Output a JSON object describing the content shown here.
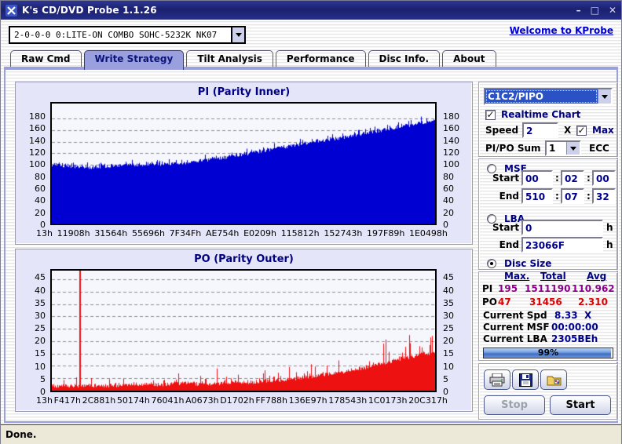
{
  "window": {
    "title": "K's CD/DVD Probe 1.1.26",
    "minimize_glyph": "–",
    "maximize_glyph": "□",
    "close_glyph": "✕"
  },
  "toolbar": {
    "drive": "2-0-0-0 0:LITE-ON COMBO SOHC-5232K NK07",
    "welcome_link": "Welcome to KProbe"
  },
  "tabs": [
    {
      "label": "Raw Cmd",
      "active": false
    },
    {
      "label": "Write Strategy",
      "active": true
    },
    {
      "label": "Tilt Analysis",
      "active": false
    },
    {
      "label": "Performance",
      "active": false
    },
    {
      "label": "Disc Info.",
      "active": false
    },
    {
      "label": "About",
      "active": false
    }
  ],
  "chart_data": [
    {
      "name": "pi-parity-inner",
      "type": "area",
      "title": "PI (Parity Inner)",
      "color": "#0000d2",
      "plot_bg": "#f6f6fd",
      "ylim": [
        0,
        205
      ],
      "yticks": [
        0,
        20,
        40,
        60,
        80,
        100,
        120,
        140,
        160,
        180
      ],
      "x_labels": [
        "13h",
        "11908h",
        "31564h",
        "55696h",
        "7F34Fh",
        "AE754h",
        "E0209h",
        "115812h",
        "152743h",
        "197F89h",
        "1E0498h"
      ],
      "trend": [
        [
          0,
          100
        ],
        [
          0.05,
          98
        ],
        [
          0.1,
          96
        ],
        [
          0.15,
          98
        ],
        [
          0.2,
          100
        ],
        [
          0.25,
          101
        ],
        [
          0.3,
          102
        ],
        [
          0.35,
          104
        ],
        [
          0.4,
          108
        ],
        [
          0.45,
          113
        ],
        [
          0.5,
          118
        ],
        [
          0.55,
          124
        ],
        [
          0.6,
          130
        ],
        [
          0.65,
          136
        ],
        [
          0.7,
          141
        ],
        [
          0.75,
          146
        ],
        [
          0.8,
          152
        ],
        [
          0.85,
          158
        ],
        [
          0.9,
          164
        ],
        [
          0.95,
          170
        ],
        [
          1,
          176
        ]
      ],
      "noise": {
        "base_offset": -3,
        "jitter": 6,
        "spike_prob": 0.35,
        "spike_max": 13,
        "spike_grow": 0.15
      },
      "min_value": 0,
      "seed": 20050
    },
    {
      "name": "po-parity-outer",
      "type": "area",
      "title": "PO (Parity Outer)",
      "color": "#ee1111",
      "plot_bg": "#f6f6fd",
      "ylim": [
        0,
        48.5
      ],
      "yticks": [
        0,
        5,
        10,
        15,
        20,
        25,
        30,
        35,
        40,
        45
      ],
      "x_labels": [
        "13h",
        "F417h",
        "2C881h",
        "50174h",
        "76041h",
        "A0673h",
        "D1702h",
        "FF788h",
        "136E97h",
        "178543h",
        "1C0173h",
        "20C317h"
      ],
      "trend": [
        [
          0,
          2
        ],
        [
          0.1,
          2
        ],
        [
          0.2,
          2.2
        ],
        [
          0.3,
          2.6
        ],
        [
          0.35,
          3
        ],
        [
          0.4,
          2.6
        ],
        [
          0.45,
          3
        ],
        [
          0.5,
          3.3
        ],
        [
          0.55,
          3.8
        ],
        [
          0.6,
          4.4
        ],
        [
          0.65,
          5.2
        ],
        [
          0.7,
          6.2
        ],
        [
          0.75,
          7.4
        ],
        [
          0.8,
          8.8
        ],
        [
          0.85,
          10.5
        ],
        [
          0.9,
          12.5
        ],
        [
          0.95,
          14
        ],
        [
          1,
          15.5
        ]
      ],
      "noise": {
        "base_offset": -0.8,
        "jitter": 1.6,
        "spike_prob": 0.22,
        "spike_max": 12,
        "spike_grow": 0.75
      },
      "outlier": {
        "t": 0.073,
        "value": 48.5
      },
      "min_value": 0.6,
      "seed": 8123
    }
  ],
  "controls": {
    "mode_select": {
      "value": "C1C2/PIPO"
    },
    "realtime": {
      "label": "Realtime Chart",
      "checked": true
    },
    "speed": {
      "label": "Speed",
      "value": "2",
      "unit": "X"
    },
    "max": {
      "label": "Max",
      "checked": true
    },
    "sum": {
      "label": "PI/PO Sum",
      "value": "1",
      "unit": "ECC"
    },
    "msf": {
      "label": "MSF",
      "selected": false,
      "start_label": "Start",
      "end_label": "End",
      "separator": ":",
      "start": [
        "00",
        "02",
        "00"
      ],
      "end": [
        "510",
        "07",
        "32"
      ]
    },
    "lba": {
      "label": "LBA",
      "selected": false,
      "start_label": "Start",
      "end_label": "End",
      "start": "0",
      "end": "23066F",
      "unit": "h"
    },
    "disc_size": {
      "label": "Disc Size",
      "selected": true
    }
  },
  "stats": {
    "headers": [
      "Max.",
      "Total",
      "Avg"
    ],
    "rows": [
      {
        "label": "PI",
        "max": "195",
        "total": "1511190",
        "avg": "110.962",
        "color": "#8b008b"
      },
      {
        "label": "PO",
        "max": "47",
        "total": "31456",
        "avg": "2.310",
        "color": "#dd0000"
      }
    ],
    "current": [
      {
        "label": "Current Spd",
        "value": "8.33",
        "unit": "X"
      },
      {
        "label": "Current MSF",
        "value": "00:00:00"
      },
      {
        "label": "Current LBA",
        "value": "2305BEh"
      }
    ],
    "progress_pct": 99,
    "progress_label": "99%"
  },
  "actions": {
    "stop": "Stop",
    "start": "Start",
    "stop_enabled": false
  },
  "statusbar": {
    "text": "Done."
  }
}
